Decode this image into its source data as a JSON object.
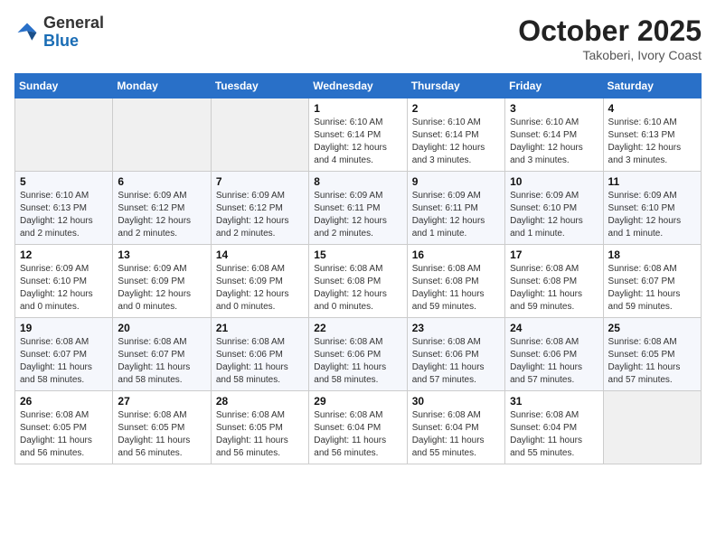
{
  "logo": {
    "general": "General",
    "blue": "Blue"
  },
  "header": {
    "month": "October 2025",
    "location": "Takoberi, Ivory Coast"
  },
  "weekdays": [
    "Sunday",
    "Monday",
    "Tuesday",
    "Wednesday",
    "Thursday",
    "Friday",
    "Saturday"
  ],
  "weeks": [
    [
      {
        "day": "",
        "info": ""
      },
      {
        "day": "",
        "info": ""
      },
      {
        "day": "",
        "info": ""
      },
      {
        "day": "1",
        "info": "Sunrise: 6:10 AM\nSunset: 6:14 PM\nDaylight: 12 hours\nand 4 minutes."
      },
      {
        "day": "2",
        "info": "Sunrise: 6:10 AM\nSunset: 6:14 PM\nDaylight: 12 hours\nand 3 minutes."
      },
      {
        "day": "3",
        "info": "Sunrise: 6:10 AM\nSunset: 6:14 PM\nDaylight: 12 hours\nand 3 minutes."
      },
      {
        "day": "4",
        "info": "Sunrise: 6:10 AM\nSunset: 6:13 PM\nDaylight: 12 hours\nand 3 minutes."
      }
    ],
    [
      {
        "day": "5",
        "info": "Sunrise: 6:10 AM\nSunset: 6:13 PM\nDaylight: 12 hours\nand 2 minutes."
      },
      {
        "day": "6",
        "info": "Sunrise: 6:09 AM\nSunset: 6:12 PM\nDaylight: 12 hours\nand 2 minutes."
      },
      {
        "day": "7",
        "info": "Sunrise: 6:09 AM\nSunset: 6:12 PM\nDaylight: 12 hours\nand 2 minutes."
      },
      {
        "day": "8",
        "info": "Sunrise: 6:09 AM\nSunset: 6:11 PM\nDaylight: 12 hours\nand 2 minutes."
      },
      {
        "day": "9",
        "info": "Sunrise: 6:09 AM\nSunset: 6:11 PM\nDaylight: 12 hours\nand 1 minute."
      },
      {
        "day": "10",
        "info": "Sunrise: 6:09 AM\nSunset: 6:10 PM\nDaylight: 12 hours\nand 1 minute."
      },
      {
        "day": "11",
        "info": "Sunrise: 6:09 AM\nSunset: 6:10 PM\nDaylight: 12 hours\nand 1 minute."
      }
    ],
    [
      {
        "day": "12",
        "info": "Sunrise: 6:09 AM\nSunset: 6:10 PM\nDaylight: 12 hours\nand 0 minutes."
      },
      {
        "day": "13",
        "info": "Sunrise: 6:09 AM\nSunset: 6:09 PM\nDaylight: 12 hours\nand 0 minutes."
      },
      {
        "day": "14",
        "info": "Sunrise: 6:08 AM\nSunset: 6:09 PM\nDaylight: 12 hours\nand 0 minutes."
      },
      {
        "day": "15",
        "info": "Sunrise: 6:08 AM\nSunset: 6:08 PM\nDaylight: 12 hours\nand 0 minutes."
      },
      {
        "day": "16",
        "info": "Sunrise: 6:08 AM\nSunset: 6:08 PM\nDaylight: 11 hours\nand 59 minutes."
      },
      {
        "day": "17",
        "info": "Sunrise: 6:08 AM\nSunset: 6:08 PM\nDaylight: 11 hours\nand 59 minutes."
      },
      {
        "day": "18",
        "info": "Sunrise: 6:08 AM\nSunset: 6:07 PM\nDaylight: 11 hours\nand 59 minutes."
      }
    ],
    [
      {
        "day": "19",
        "info": "Sunrise: 6:08 AM\nSunset: 6:07 PM\nDaylight: 11 hours\nand 58 minutes."
      },
      {
        "day": "20",
        "info": "Sunrise: 6:08 AM\nSunset: 6:07 PM\nDaylight: 11 hours\nand 58 minutes."
      },
      {
        "day": "21",
        "info": "Sunrise: 6:08 AM\nSunset: 6:06 PM\nDaylight: 11 hours\nand 58 minutes."
      },
      {
        "day": "22",
        "info": "Sunrise: 6:08 AM\nSunset: 6:06 PM\nDaylight: 11 hours\nand 58 minutes."
      },
      {
        "day": "23",
        "info": "Sunrise: 6:08 AM\nSunset: 6:06 PM\nDaylight: 11 hours\nand 57 minutes."
      },
      {
        "day": "24",
        "info": "Sunrise: 6:08 AM\nSunset: 6:06 PM\nDaylight: 11 hours\nand 57 minutes."
      },
      {
        "day": "25",
        "info": "Sunrise: 6:08 AM\nSunset: 6:05 PM\nDaylight: 11 hours\nand 57 minutes."
      }
    ],
    [
      {
        "day": "26",
        "info": "Sunrise: 6:08 AM\nSunset: 6:05 PM\nDaylight: 11 hours\nand 56 minutes."
      },
      {
        "day": "27",
        "info": "Sunrise: 6:08 AM\nSunset: 6:05 PM\nDaylight: 11 hours\nand 56 minutes."
      },
      {
        "day": "28",
        "info": "Sunrise: 6:08 AM\nSunset: 6:05 PM\nDaylight: 11 hours\nand 56 minutes."
      },
      {
        "day": "29",
        "info": "Sunrise: 6:08 AM\nSunset: 6:04 PM\nDaylight: 11 hours\nand 56 minutes."
      },
      {
        "day": "30",
        "info": "Sunrise: 6:08 AM\nSunset: 6:04 PM\nDaylight: 11 hours\nand 55 minutes."
      },
      {
        "day": "31",
        "info": "Sunrise: 6:08 AM\nSunset: 6:04 PM\nDaylight: 11 hours\nand 55 minutes."
      },
      {
        "day": "",
        "info": ""
      }
    ]
  ]
}
